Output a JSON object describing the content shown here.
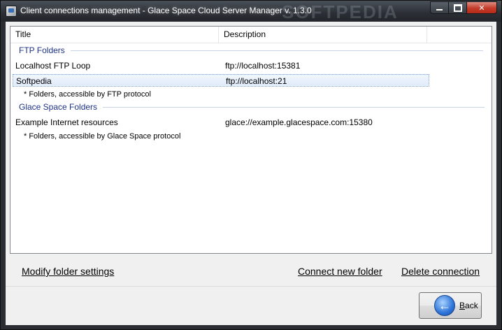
{
  "window": {
    "title": "Client connections management - Glace Space Cloud Server Manager v. 1.3.0",
    "watermark": "SOFTPEDIA"
  },
  "list": {
    "columns": [
      "Title",
      "Description",
      ""
    ],
    "groups": [
      {
        "name": "FTP Folders",
        "items": [
          {
            "title": "Localhost FTP Loop",
            "description": "ftp://localhost:15381"
          },
          {
            "title": "Softpedia",
            "description": "ftp://localhost:21",
            "selected": true
          }
        ],
        "note": "* Folders, accessible by FTP protocol"
      },
      {
        "name": "Glace Space Folders",
        "items": [
          {
            "title": "Example Internet resources",
            "description": "glace://example.glacespace.com:15380"
          }
        ],
        "note": "* Folders, accessible by Glace Space protocol"
      }
    ]
  },
  "actions": {
    "modify": "Modify folder settings",
    "connect": "Connect new folder",
    "delete": "Delete connection"
  },
  "footer": {
    "back_label_underlined": "B",
    "back_label_rest": "ack"
  }
}
